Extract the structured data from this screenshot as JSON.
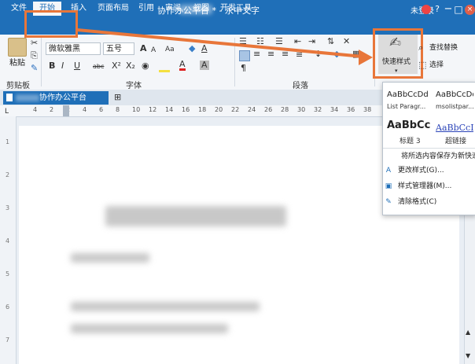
{
  "titlebar": {
    "title": "协作办公平台 * - 永中文字",
    "login": "未登录",
    "min": "−",
    "restore": "□",
    "close": "×",
    "extra": "?"
  },
  "tabs": [
    "文件",
    "开始",
    "插入",
    "页面布局",
    "引用",
    "审阅",
    "视图",
    "开发工具"
  ],
  "ribbon": {
    "paste": "粘贴",
    "clipboard_group": "剪贴板",
    "font_name": "微软雅黑",
    "font_size": "五号",
    "font_group": "字体",
    "paragraph_group": "段落",
    "quick_styles": "快速样式",
    "find_replace": "查找替换",
    "select": "选择",
    "bold": "B",
    "italic": "I",
    "underline": "U",
    "strike": "abc",
    "grow_font": "A",
    "shrink_font": "A",
    "change_case": "Aa",
    "pilcrow": "¶"
  },
  "doc_tab": "协作办公平台",
  "ruler_numbers": [
    "4",
    "2",
    "2",
    "4",
    "6",
    "8",
    "10",
    "12",
    "14",
    "16",
    "18",
    "20",
    "22",
    "24",
    "26",
    "28",
    "30",
    "32",
    "34",
    "36",
    "38"
  ],
  "vruler_numbers": [
    "1",
    "2",
    "3",
    "4",
    "5",
    "6",
    "7"
  ],
  "styles_pane": {
    "styles": [
      {
        "sample": "AaBbCcDd",
        "name": "List Paragr..."
      },
      {
        "sample": "AaBbCcDd",
        "name": "msolistpar..."
      },
      {
        "sample": "AaBbCcI",
        "name": "标题 3"
      },
      {
        "sample": "AaBbCcDd",
        "name": "超链接"
      }
    ],
    "save_as_new": "将所选内容保存为新快速样式...",
    "change_style": "更改样式(G)...",
    "style_manager": "样式管理器(M)...",
    "clear_format": "清除格式(C)"
  },
  "colors": {
    "accent": "#1f6fb8",
    "highlight": "#e8763a"
  }
}
